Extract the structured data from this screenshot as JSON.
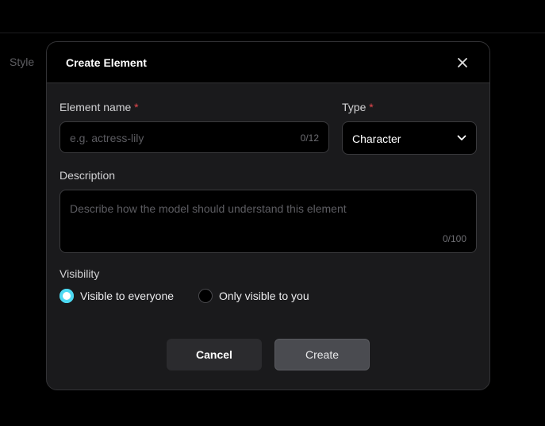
{
  "background": {
    "style_label": "Style"
  },
  "modal": {
    "title": "Create Element",
    "close_icon": "close-icon"
  },
  "form": {
    "element_name": {
      "label": "Element name",
      "required_mark": "*",
      "placeholder": "e.g. actress-lily",
      "counter": "0/12"
    },
    "type": {
      "label": "Type",
      "required_mark": "*",
      "selected": "Character",
      "icon": "chevron-down-icon"
    },
    "description": {
      "label": "Description",
      "placeholder": "Describe how the model should understand this element",
      "counter": "0/100"
    },
    "visibility": {
      "label": "Visibility",
      "options": [
        {
          "label": "Visible to everyone",
          "selected": true
        },
        {
          "label": "Only visible to you",
          "selected": false
        }
      ]
    }
  },
  "actions": {
    "cancel_label": "Cancel",
    "create_label": "Create"
  },
  "colors": {
    "accent": "#4dd9f2",
    "required": "#e5484d",
    "modal_bg": "#1a1a1c",
    "page_bg": "#000000"
  }
}
